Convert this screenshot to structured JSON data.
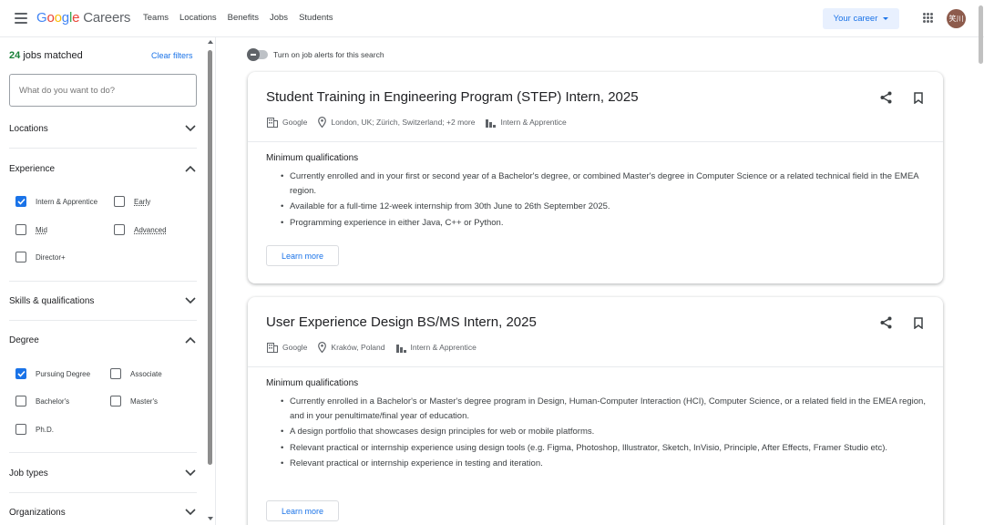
{
  "header": {
    "logo_google": "Google",
    "logo_careers": "Careers",
    "nav": [
      "Teams",
      "Locations",
      "Benefits",
      "Jobs",
      "Students"
    ],
    "your_career": "Your career",
    "avatar_text": "笑川"
  },
  "sidebar": {
    "jobs_count_number": "24",
    "jobs_count_text": "jobs matched",
    "clear_filters": "Clear filters",
    "search_placeholder": "What do you want to do?",
    "sections": {
      "locations": "Locations",
      "experience": "Experience",
      "skills": "Skills & qualifications",
      "degree": "Degree",
      "job_types": "Job types",
      "organizations": "Organizations"
    },
    "experience_options": [
      {
        "label": "Intern & Apprentice",
        "checked": true
      },
      {
        "label": "Early",
        "checked": false
      },
      {
        "label": "Mid",
        "checked": false
      },
      {
        "label": "Advanced",
        "checked": false
      },
      {
        "label": "Director+",
        "checked": false
      }
    ],
    "degree_options": [
      {
        "label": "Pursuing Degree",
        "checked": true
      },
      {
        "label": "Associate",
        "checked": false
      },
      {
        "label": "Bachelor's",
        "checked": false
      },
      {
        "label": "Master's",
        "checked": false
      },
      {
        "label": "Ph.D.",
        "checked": false
      }
    ]
  },
  "main": {
    "alerts_label": "Turn on job alerts for this search",
    "jobs": [
      {
        "title": "Student Training in Engineering Program (STEP) Intern, 2025",
        "company": "Google",
        "location": "London, UK; Zürich, Switzerland; +2 more",
        "level": "Intern & Apprentice",
        "min_q_heading": "Minimum qualifications",
        "qualifications": [
          "Currently enrolled and in your first or second year of a Bachelor's degree, or combined Master's degree in Computer Science or a related technical field in the EMEA region.",
          "Available for a full-time 12-week internship from 30th June to 26th September 2025.",
          "Programming experience in either Java, C++ or Python."
        ],
        "learn_more": "Learn more"
      },
      {
        "title": "User Experience Design BS/MS Intern, 2025",
        "company": "Google",
        "location": "Kraków, Poland",
        "level": "Intern & Apprentice",
        "min_q_heading": "Minimum qualifications",
        "qualifications": [
          "Currently enrolled in a Bachelor's or Master's degree program in Design, Human-Computer Interaction (HCI), Computer Science, or a related field in the EMEA region, and in your penultimate/final year of education.",
          "A design portfolio that showcases design principles for web or mobile platforms.",
          "Relevant practical or internship experience using design tools (e.g. Figma, Photoshop, Illustrator, Sketch, InVisio, Principle, After Effects, Framer Studio etc).",
          "Relevant practical or internship experience in testing and iteration."
        ],
        "learn_more": "Learn more"
      }
    ]
  },
  "colors": {
    "accent": "#1a73e8",
    "count_green": "#188038",
    "avatar_bg": "#8d5b4c"
  }
}
